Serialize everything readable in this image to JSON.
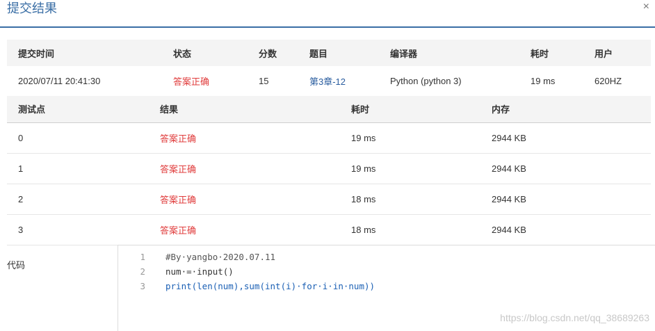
{
  "dialog": {
    "title": "提交结果",
    "close_icon": "×"
  },
  "summary": {
    "headers": [
      "提交时间",
      "状态",
      "分数",
      "题目",
      "编译器",
      "耗时",
      "用户"
    ],
    "row": {
      "time": "2020/07/11 20:41:30",
      "status": "答案正确",
      "score": "15",
      "problem": "第3章-12",
      "compiler": "Python (python 3)",
      "elapsed": "19 ms",
      "user": "620HZ"
    }
  },
  "test_points": {
    "headers": [
      "测试点",
      "结果",
      "耗时",
      "内存"
    ],
    "rows": [
      {
        "id": "0",
        "result": "答案正确",
        "elapsed": "19 ms",
        "memory": "2944 KB"
      },
      {
        "id": "1",
        "result": "答案正确",
        "elapsed": "19 ms",
        "memory": "2944 KB"
      },
      {
        "id": "2",
        "result": "答案正确",
        "elapsed": "18 ms",
        "memory": "2944 KB"
      },
      {
        "id": "3",
        "result": "答案正确",
        "elapsed": "18 ms",
        "memory": "2944 KB"
      }
    ]
  },
  "code": {
    "label": "代码",
    "lines": [
      {
        "num": "1",
        "text": "#By·yangbo·2020.07.11"
      },
      {
        "num": "2",
        "text": "num·=·input()"
      },
      {
        "num": "3",
        "text": "print(len(num),sum(int(i)·for·i·in·num))"
      }
    ]
  },
  "watermark": "https://blog.csdn.net/qq_38689263",
  "colors": {
    "accent": "#3a6ea5",
    "success_red": "#e03c3c",
    "link": "#2a5d9f"
  }
}
